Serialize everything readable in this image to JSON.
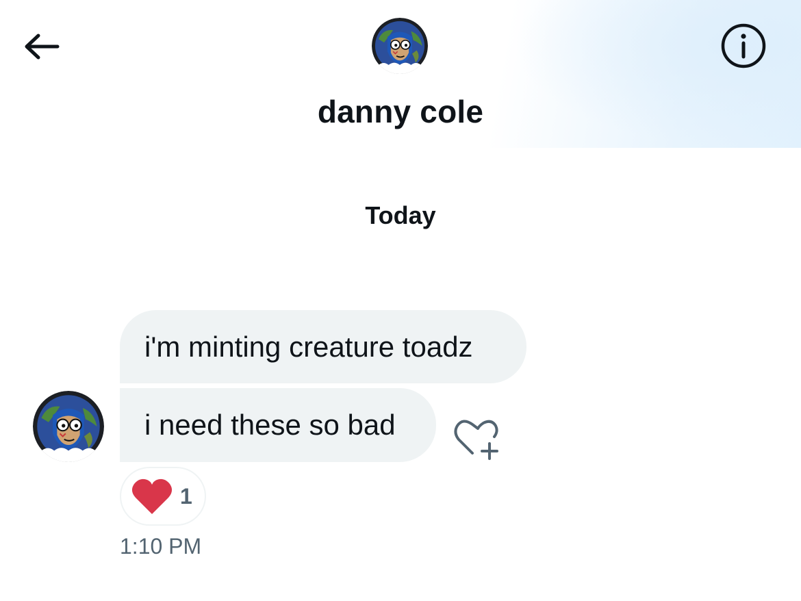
{
  "header": {
    "back_icon": "arrow-left-icon",
    "info_icon": "info-circle-icon",
    "contact_name": "danny cole"
  },
  "conversation": {
    "date_separator": "Today",
    "messages": [
      {
        "text": "i'm minting creature toadz"
      },
      {
        "text": "i need these so bad"
      }
    ],
    "reaction": {
      "emoji_icon": "red-heart-icon",
      "count": "1"
    },
    "add_reaction_icon": "heart-plus-icon",
    "timestamp": "1:10 PM"
  },
  "colors": {
    "bubble_bg": "#eff3f4",
    "text_primary": "#0f1419",
    "text_secondary": "#536471",
    "heart": "#d9364a",
    "header_tint": "#e1f1fd"
  }
}
